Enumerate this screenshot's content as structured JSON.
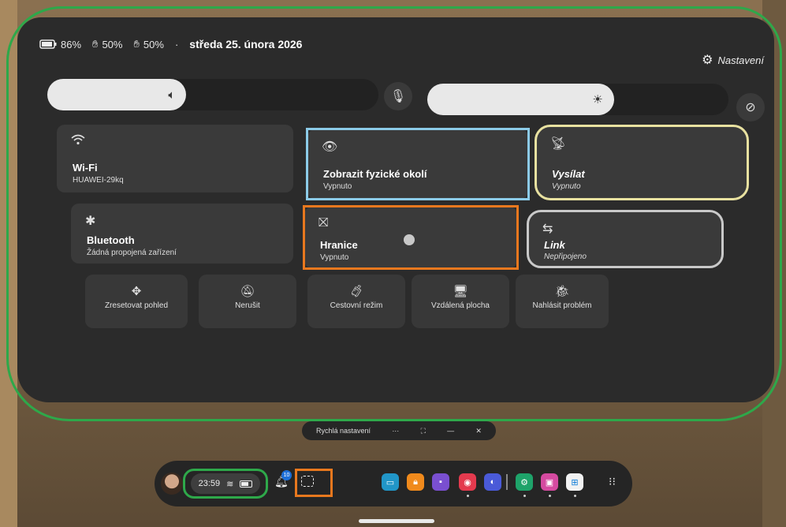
{
  "status": {
    "battery_headset": "86%",
    "controller_left": "50%",
    "controller_right": "50%",
    "separator": "·",
    "date": "středa 25. února 2026"
  },
  "settings": {
    "label": "Nastavení"
  },
  "sliders": {
    "volume_level": 0.42,
    "brightness_level": 0.62
  },
  "tiles": {
    "wifi": {
      "title": "Wi-Fi",
      "subtitle": "HUAWEI-29kq"
    },
    "passthrough": {
      "title": "Zobrazit fyzické okolí",
      "subtitle": "Vypnuto"
    },
    "cast": {
      "title": "Vysílat",
      "subtitle": "Vypnuto"
    },
    "bluetooth": {
      "title": "Bluetooth",
      "subtitle": "Žádná propojená zařízení"
    },
    "boundary": {
      "title": "Hranice",
      "subtitle": "Vypnuto"
    },
    "link": {
      "title": "Link",
      "subtitle": "Nepřipojeno"
    }
  },
  "actions": [
    {
      "label": "Zresetovat pohled",
      "icon": "recenter-icon"
    },
    {
      "label": "Nerušit",
      "icon": "do-not-disturb-icon"
    },
    {
      "label": "Cestovní režim",
      "icon": "travel-mode-icon"
    },
    {
      "label": "Vzdálená plocha",
      "icon": "remote-desktop-icon"
    },
    {
      "label": "Nahlásit problém",
      "icon": "bug-report-icon"
    }
  ],
  "window": {
    "title": "Rychlá nastavení",
    "more": "···",
    "resize": "⛶",
    "minimize": "—",
    "close": "✕"
  },
  "taskbar": {
    "time": "23:59",
    "notification_count": "10",
    "apps": [
      "store-app",
      "lock-app",
      "chat-app",
      "camera-app",
      "browser-app",
      "settings-app",
      "gallery-app",
      "windows-app"
    ],
    "colors": {
      "accent_green": "#2ea84a",
      "accent_orange": "#e8781e",
      "accent_blue": "#8ccbe8",
      "accent_yellow": "#e8e1a0",
      "accent_grey": "#c9c9c9"
    }
  }
}
